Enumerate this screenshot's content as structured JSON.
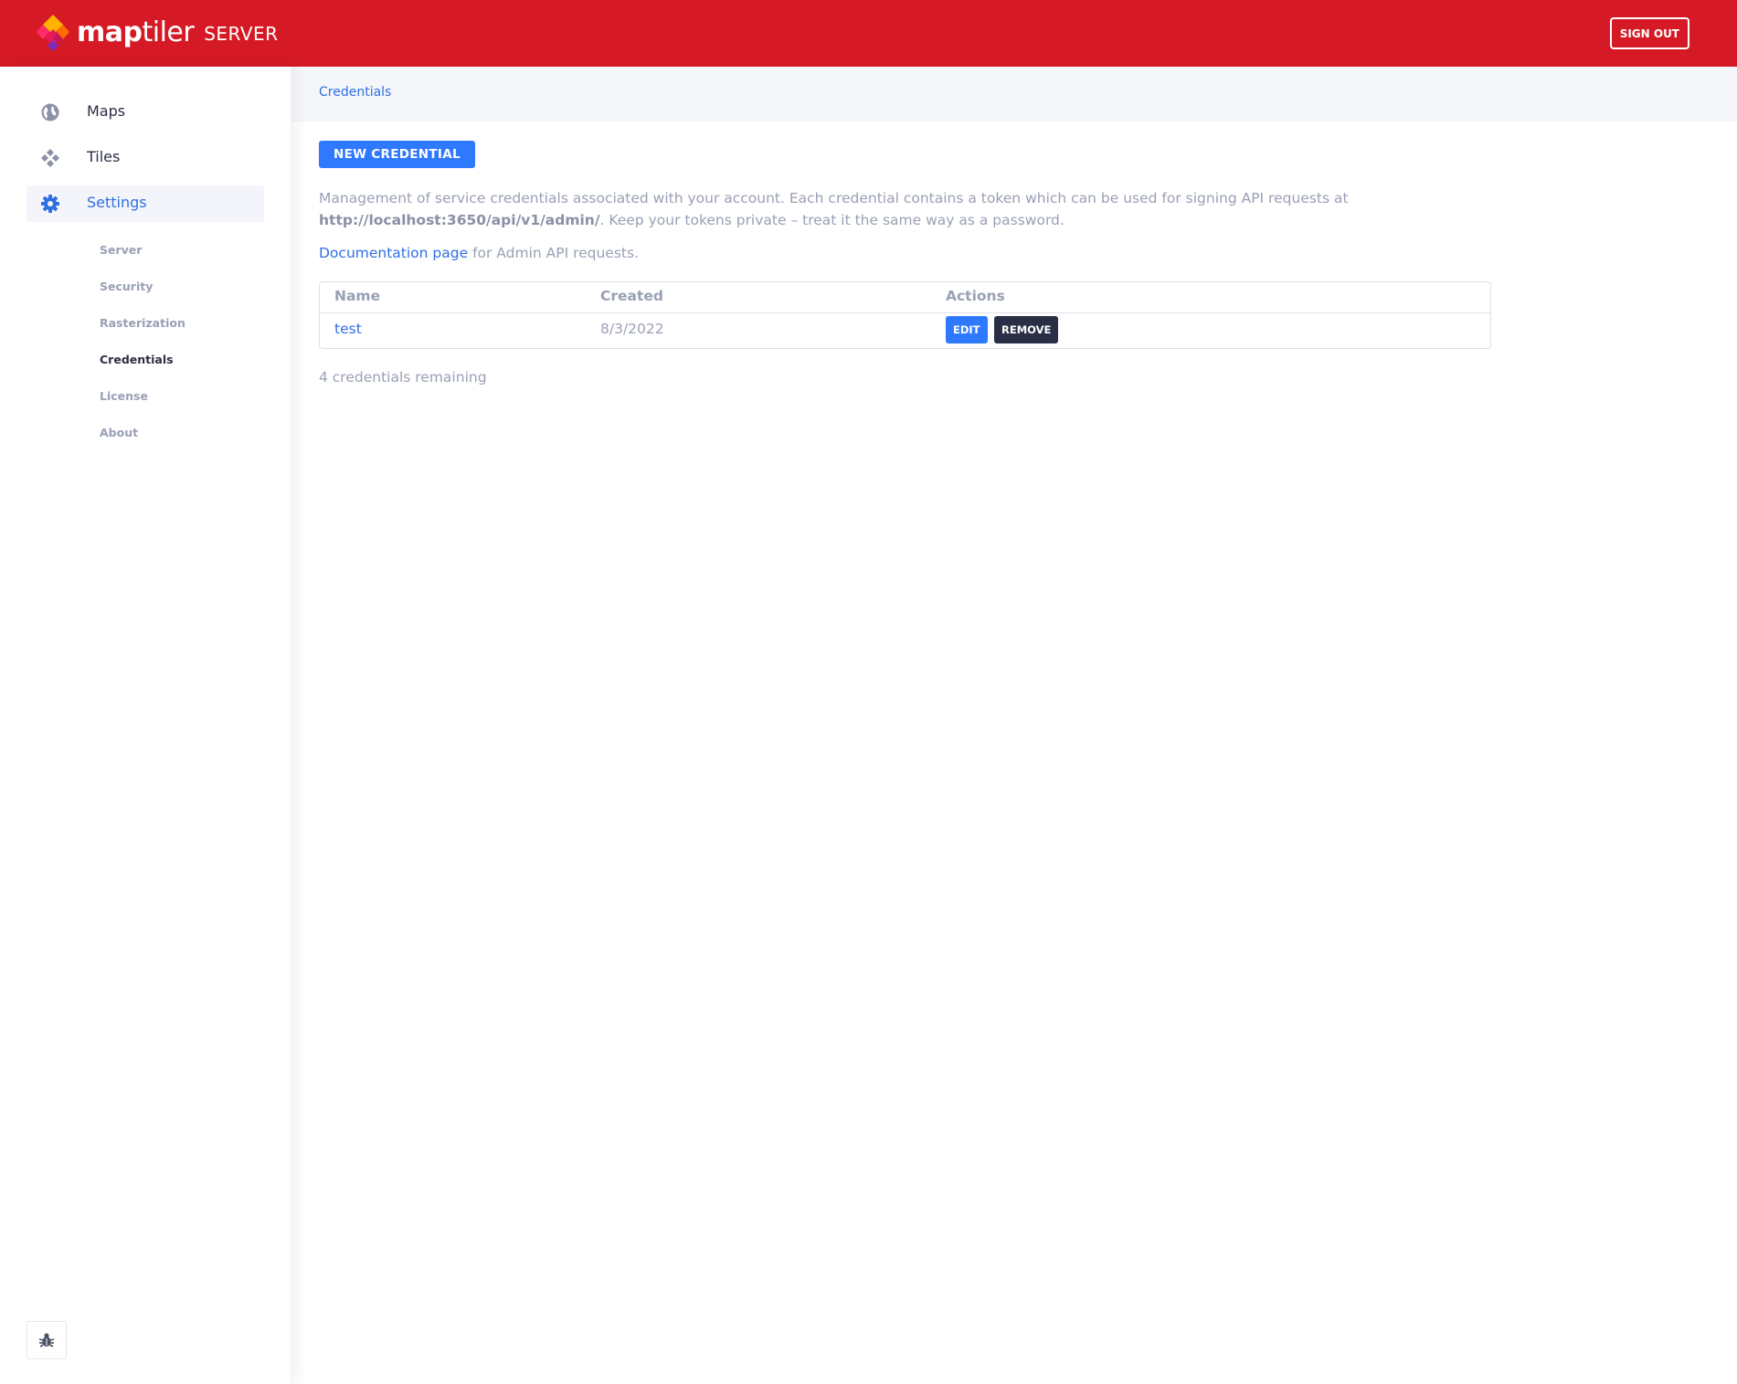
{
  "header": {
    "brand_bold": "map",
    "brand_light": "tiler",
    "product": "SERVER",
    "signout_label": "SIGN OUT",
    "colors": {
      "bar": "#d51a25"
    }
  },
  "sidebar": {
    "items": [
      {
        "label": "Maps",
        "icon": "globe-icon"
      },
      {
        "label": "Tiles",
        "icon": "tiles-icon"
      },
      {
        "label": "Settings",
        "icon": "gear-icon"
      }
    ],
    "subitems": [
      {
        "label": "Server"
      },
      {
        "label": "Security"
      },
      {
        "label": "Rasterization"
      },
      {
        "label": "Credentials"
      },
      {
        "label": "License"
      },
      {
        "label": "About"
      }
    ],
    "bug_icon": "bug-icon"
  },
  "breadcrumb": "Credentials",
  "main": {
    "new_button": "NEW CREDENTIAL",
    "desc_text": "Management of service credentials associated with your account. Each credential contains a token which can be used for signing API requests at",
    "desc_url": "http://localhost:3650/api/v1/admin/",
    "desc_tail": ". Keep your tokens private – treat it the same way as a password.",
    "doc_link": "Documentation page",
    "doc_tail": " for Admin API requests.",
    "table": {
      "headers": [
        "Name",
        "Created",
        "Actions"
      ],
      "rows": [
        {
          "name": "test",
          "created": "8/3/2022",
          "edit": "EDIT",
          "remove": "REMOVE"
        }
      ]
    },
    "remaining": "4 credentials remaining"
  },
  "colors": {
    "accent": "#2f79ff",
    "link": "#2f6fe4",
    "dark": "#2b2f45",
    "muted": "#9aa0b5"
  }
}
